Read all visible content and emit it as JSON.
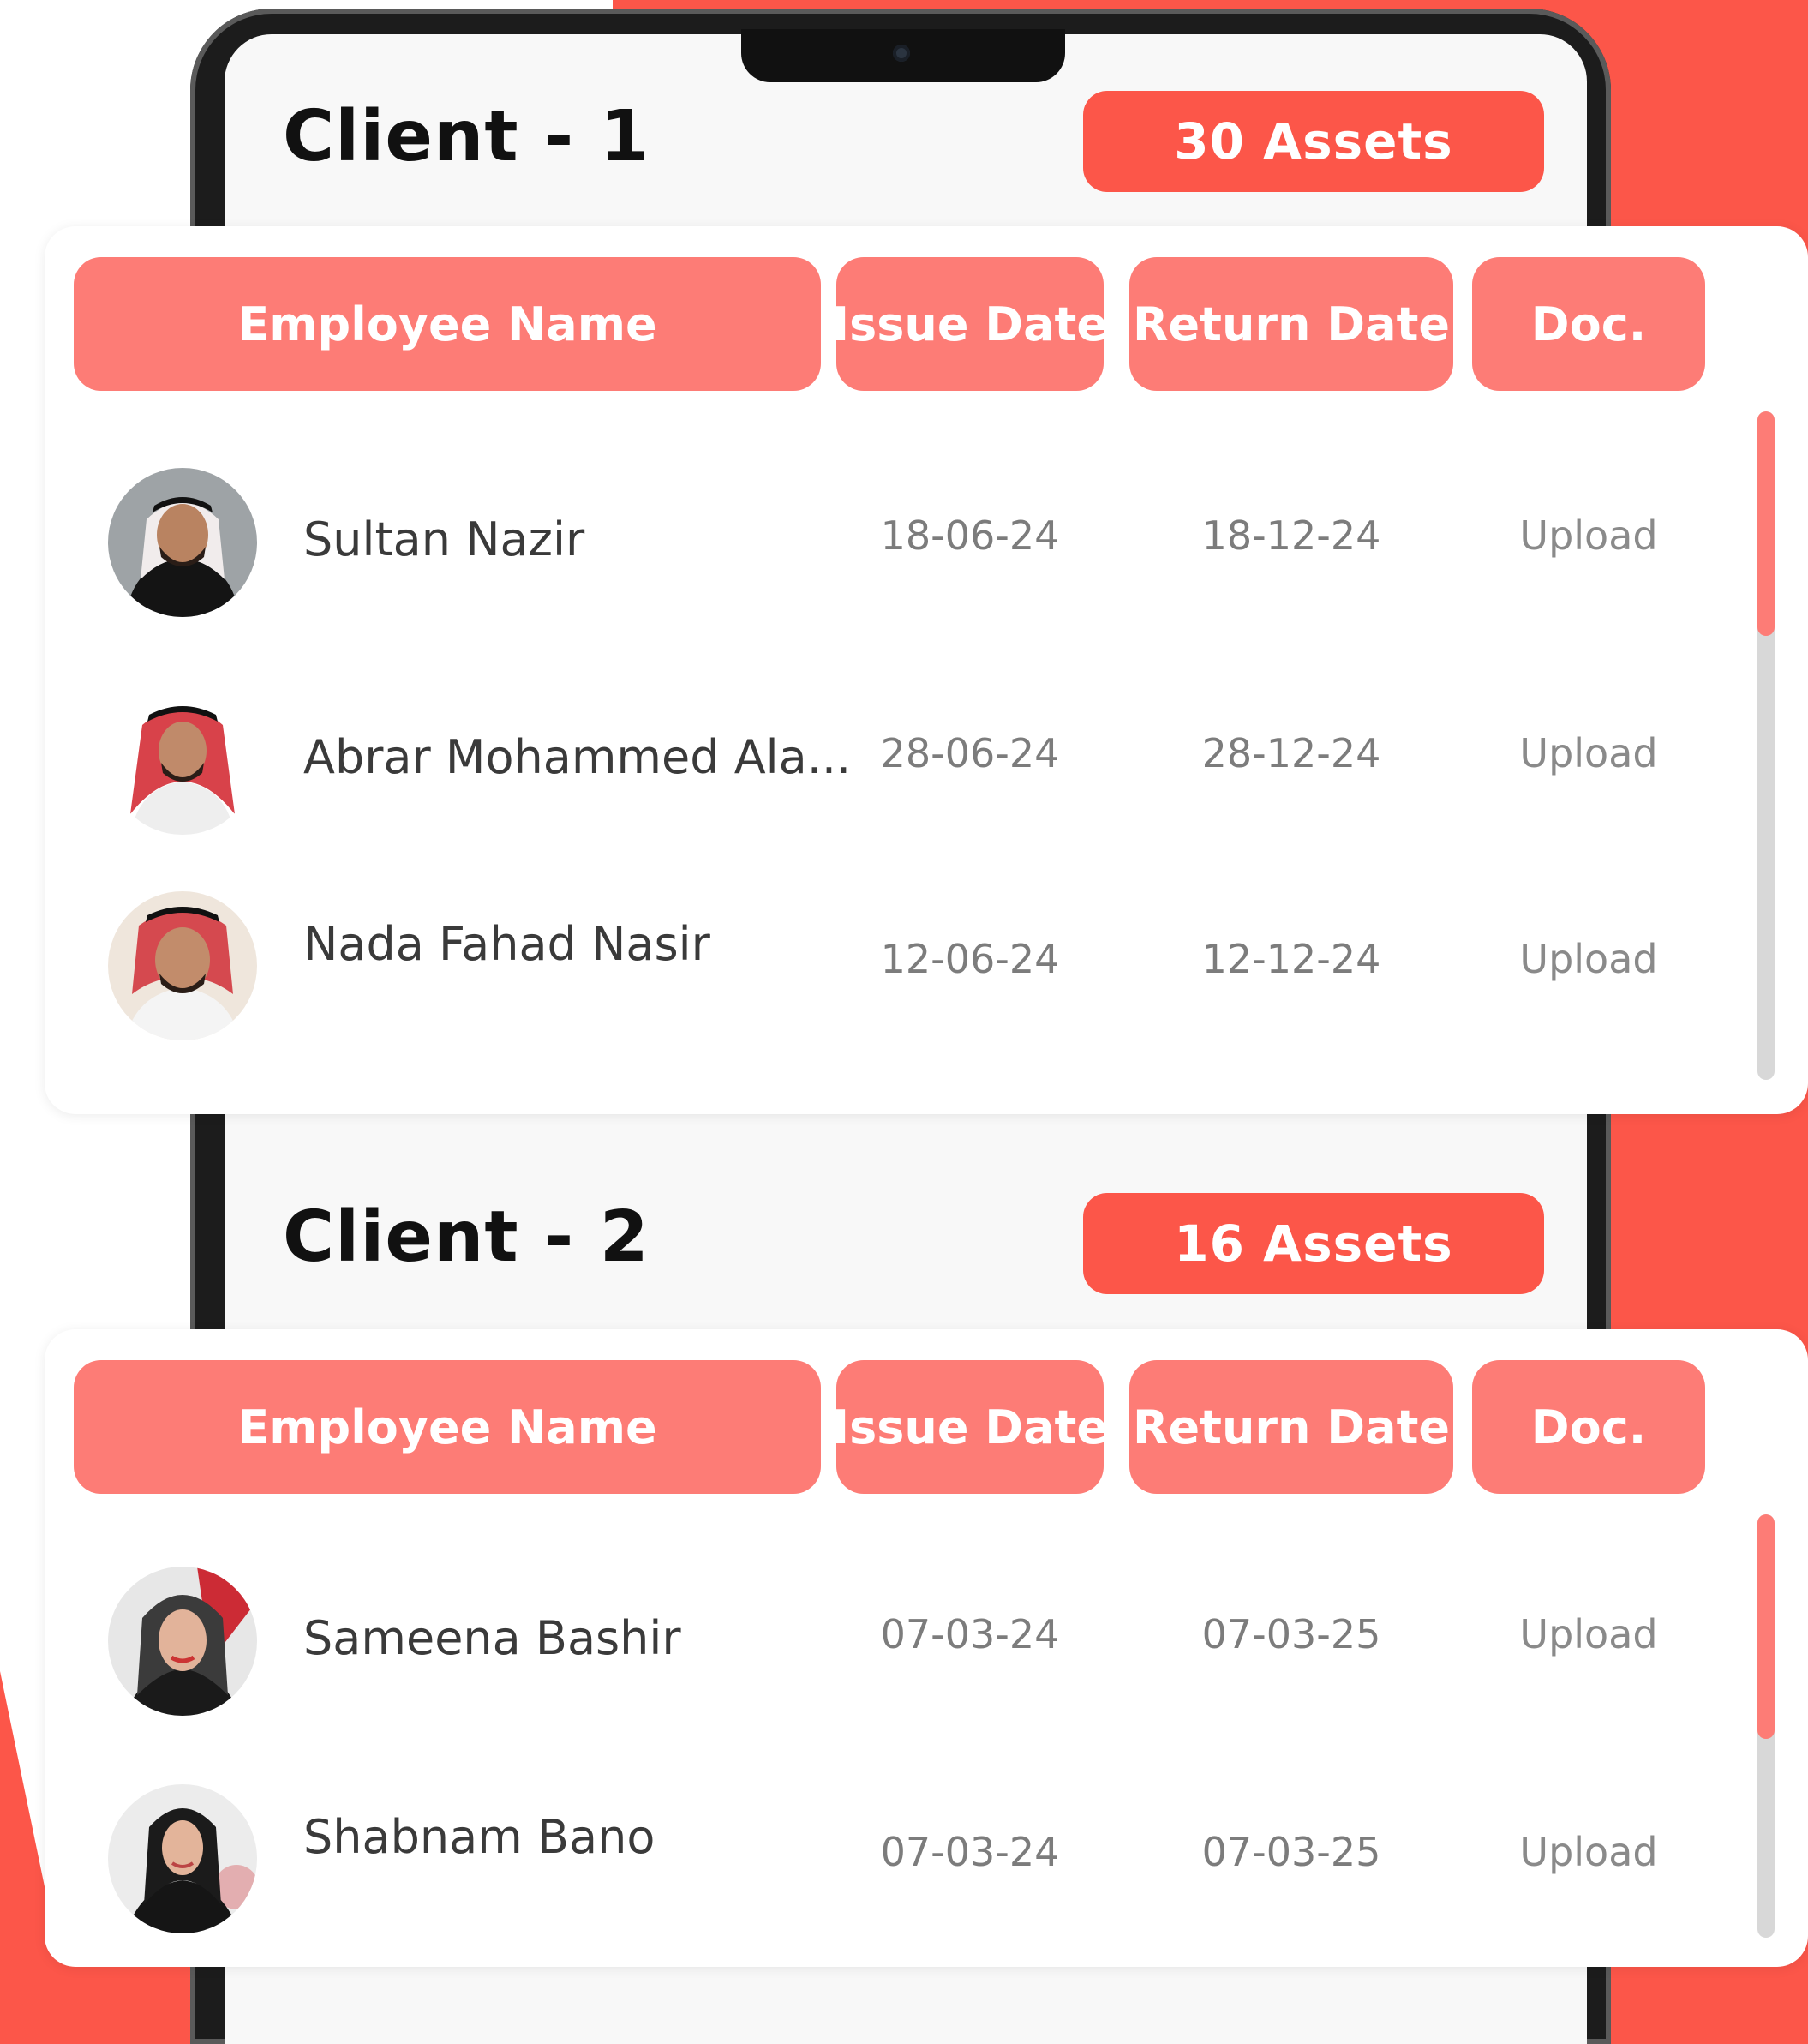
{
  "clients": [
    {
      "title": "Client - 1",
      "assets": "30 Assets",
      "headers": {
        "name": "Employee Name",
        "issue": "Issue Date",
        "return": "Return Date",
        "doc": "Doc."
      },
      "rows": [
        {
          "name": "Sultan Nazir",
          "issue": "18-06-24",
          "return": "18-12-24",
          "doc": "Upload"
        },
        {
          "name": "Abrar Mohammed Ala...",
          "issue": "28-06-24",
          "return": "28-12-24",
          "doc": "Upload"
        },
        {
          "name": "Nada Fahad Nasir",
          "issue": "12-06-24",
          "return": "12-12-24",
          "doc": "Upload"
        }
      ]
    },
    {
      "title": "Client - 2",
      "assets": "16 Assets",
      "headers": {
        "name": "Employee Name",
        "issue": "Issue Date",
        "return": "Return Date",
        "doc": "Doc."
      },
      "rows": [
        {
          "name": "Sameena Bashir",
          "issue": "07-03-24",
          "return": "07-03-25",
          "doc": "Upload"
        },
        {
          "name": "Shabnam Bano",
          "issue": "07-03-24",
          "return": "07-03-25",
          "doc": "Upload"
        }
      ]
    }
  ],
  "colors": {
    "accent": "#fc5649",
    "header": "#fd7c76",
    "background": "#f8f8f8"
  }
}
